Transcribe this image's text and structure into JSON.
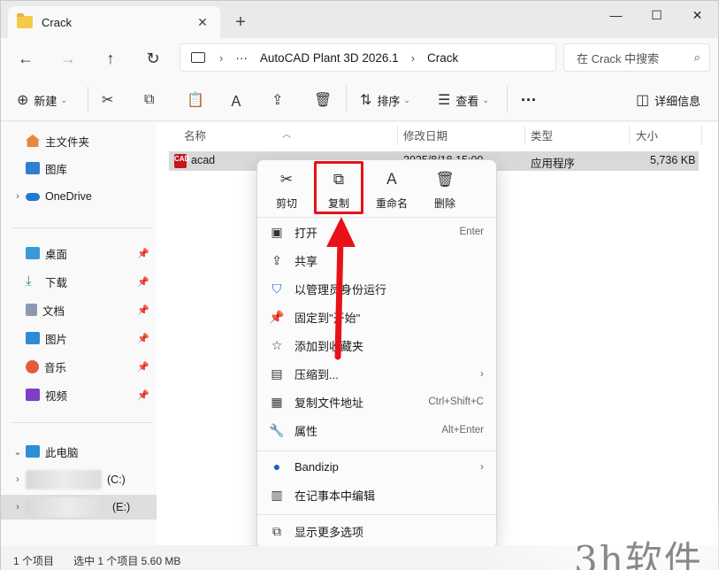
{
  "window": {
    "tab_title": "Crack",
    "new_tab": "+",
    "controls": {
      "minimize": "—",
      "maximize": "☐",
      "close": "✕"
    }
  },
  "address": {
    "more": "···",
    "segments": [
      "AutoCAD Plant 3D 2026.1",
      "Crack"
    ],
    "search_placeholder": "在 Crack 中搜索"
  },
  "toolbar": {
    "new": "新建",
    "sort": "排序",
    "view": "查看",
    "more": "···",
    "details": "详细信息"
  },
  "sidebar": {
    "home": "主文件夹",
    "gallery": "图库",
    "onedrive": "OneDrive",
    "pinned": [
      {
        "label": "桌面",
        "icon": "desktop-icon"
      },
      {
        "label": "下载",
        "icon": "download-icon"
      },
      {
        "label": "文档",
        "icon": "document-icon"
      },
      {
        "label": "图片",
        "icon": "pictures-icon"
      },
      {
        "label": "音乐",
        "icon": "music-icon"
      },
      {
        "label": "视频",
        "icon": "video-icon"
      }
    ],
    "this_pc": "此电脑",
    "drive_c": "(C:)",
    "drive_e": "(E:)"
  },
  "columns": {
    "name": "名称",
    "modified": "修改日期",
    "type": "类型",
    "size": "大小"
  },
  "file": {
    "name": "acad",
    "modified": "2025/8/18 15:00",
    "type": "应用程序",
    "size": "5,736 KB",
    "icon_text": "CAD"
  },
  "context_menu": {
    "quick": {
      "cut": "剪切",
      "copy": "复制",
      "rename": "重命名",
      "delete": "删除"
    },
    "open": "打开",
    "open_shortcut": "Enter",
    "share": "共享",
    "run_as_admin": "以管理员身份运行",
    "pin_start": "固定到\"开始\"",
    "add_favorites": "添加到收藏夹",
    "compress": "压缩到...",
    "copy_path": "复制文件地址",
    "copy_path_shortcut": "Ctrl+Shift+C",
    "properties": "属性",
    "properties_shortcut": "Alt+Enter",
    "bandizip": "Bandizip",
    "edit_notepad": "在记事本中编辑",
    "more_options": "显示更多选项"
  },
  "status": {
    "count": "1 个项目",
    "selected": "选中 1 个项目  5.60 MB"
  },
  "watermark": "3h软件",
  "colors": {
    "highlight": "#e8111a",
    "selection": "#d9d9d9"
  }
}
